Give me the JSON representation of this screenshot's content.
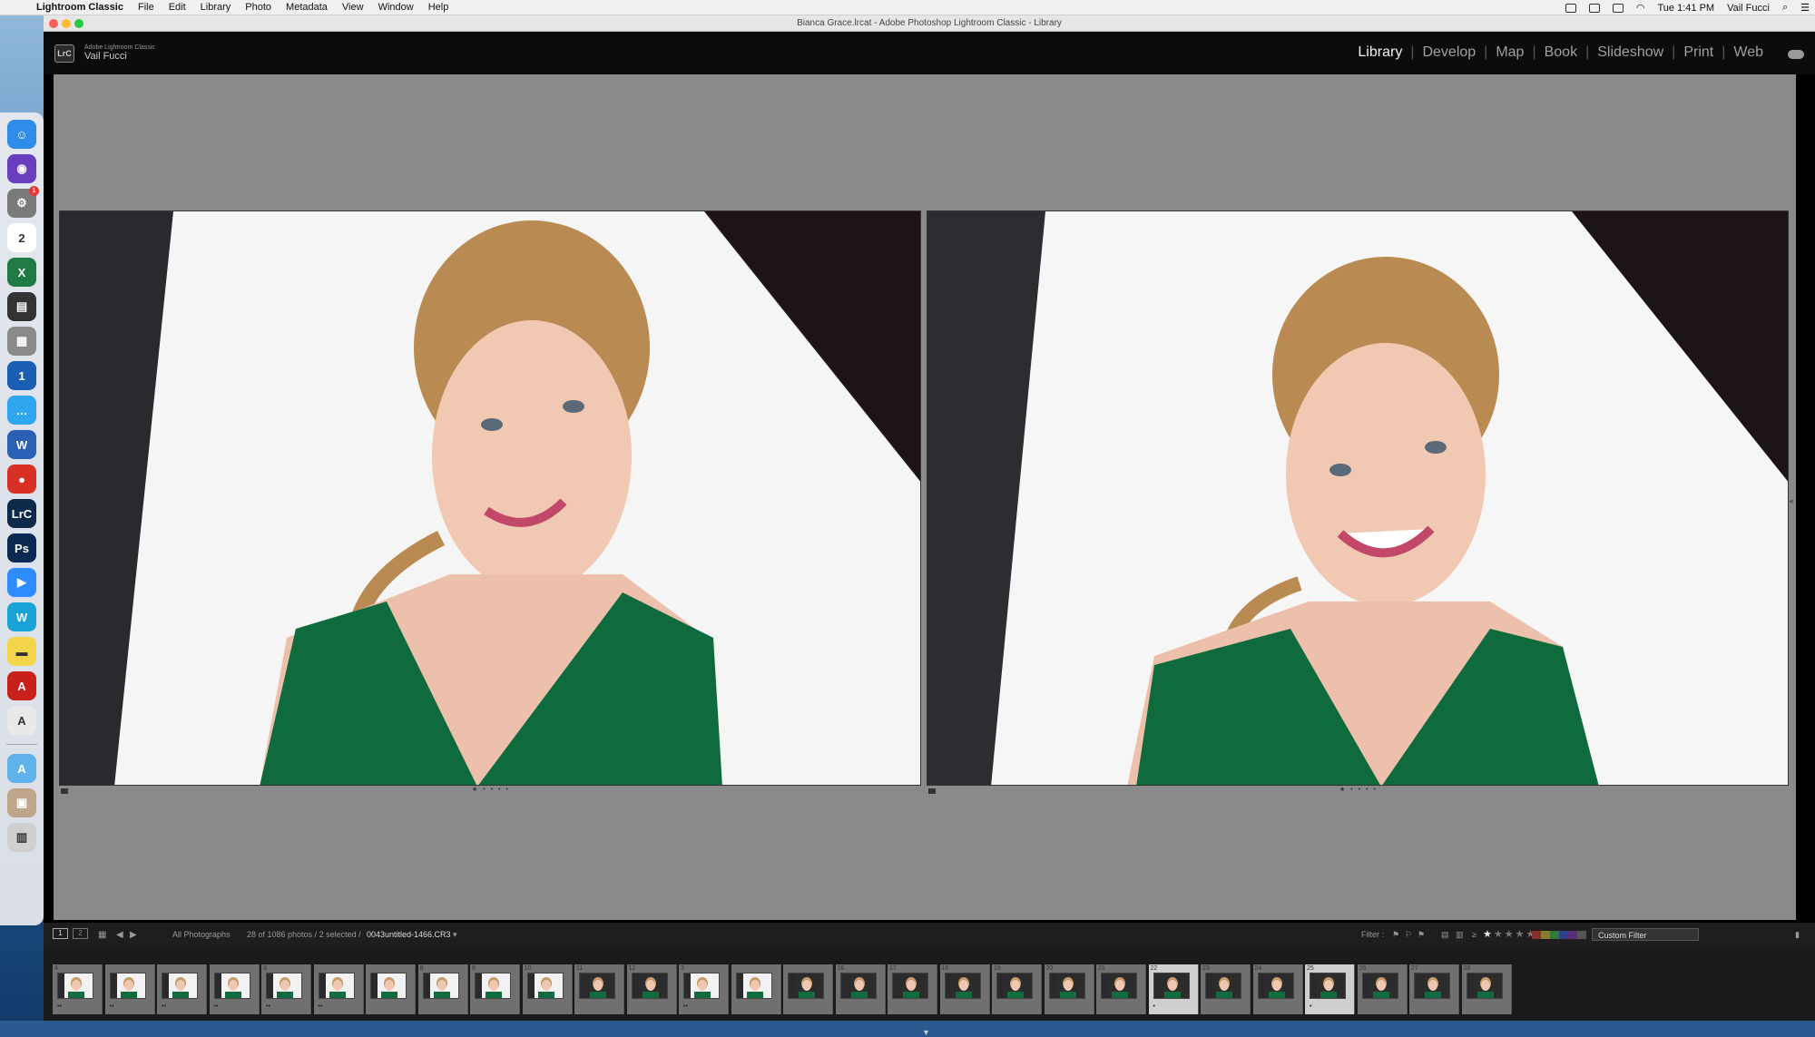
{
  "menubar": {
    "app_name": "Lightroom Classic",
    "items": [
      "File",
      "Edit",
      "Library",
      "Photo",
      "Metadata",
      "View",
      "Window",
      "Help"
    ],
    "clock": "Tue 1:41 PM",
    "user": "Vail Fucci"
  },
  "window": {
    "title": "Bianca Grace.lrcat - Adobe Photoshop Lightroom Classic - Library"
  },
  "identity": {
    "product": "Adobe Lightroom Classic",
    "user": "Vail Fucci",
    "logo_text": "LrC"
  },
  "modules": [
    {
      "label": "Library",
      "active": true
    },
    {
      "label": "Develop",
      "active": false
    },
    {
      "label": "Map",
      "active": false
    },
    {
      "label": "Book",
      "active": false
    },
    {
      "label": "Slideshow",
      "active": false
    },
    {
      "label": "Print",
      "active": false
    },
    {
      "label": "Web",
      "active": false
    }
  ],
  "filmstrip_toolbar": {
    "view1": "1",
    "view2": "2",
    "source": "All Photographs",
    "count": "28 of 1086 photos / 2 selected /",
    "filename": "0043untitled-1466.CR3",
    "filter_label": "Filter :",
    "rating_op": "≥",
    "custom_filter": "Custom Filter"
  },
  "dock": [
    {
      "name": "finder",
      "label": "☺",
      "color": "#2f8ce8"
    },
    {
      "name": "siri",
      "label": "◉",
      "color": "#6a3fbf"
    },
    {
      "name": "system-preferences",
      "label": "⚙",
      "color": "#7a7a7a",
      "badge": "1"
    },
    {
      "name": "calendar",
      "label": "2",
      "color": "#ffffff"
    },
    {
      "name": "excel",
      "label": "X",
      "color": "#1f7a44"
    },
    {
      "name": "printer",
      "label": "▤",
      "color": "#333333"
    },
    {
      "name": "calculator",
      "label": "▦",
      "color": "#8a8a8a"
    },
    {
      "name": "1password",
      "label": "1",
      "color": "#1a5fb4"
    },
    {
      "name": "messages",
      "label": "…",
      "color": "#2fa7f0"
    },
    {
      "name": "word",
      "label": "W",
      "color": "#2b5fb3"
    },
    {
      "name": "chrome",
      "label": "●",
      "color": "#d93025"
    },
    {
      "name": "lightroom-classic",
      "label": "LrC",
      "color": "#0b2a4a"
    },
    {
      "name": "photoshop",
      "label": "Ps",
      "color": "#0a2a52"
    },
    {
      "name": "zoom",
      "label": "▶",
      "color": "#2d8cff"
    },
    {
      "name": "webex",
      "label": "W",
      "color": "#19a2d6"
    },
    {
      "name": "stickies",
      "label": "▬",
      "color": "#f3d54a"
    },
    {
      "name": "acrobat",
      "label": "A",
      "color": "#c8201a"
    },
    {
      "name": "text-edit",
      "label": "A",
      "color": "#e9e9e9"
    },
    {
      "name": "applications-folder",
      "label": "A",
      "color": "#5fb2ea"
    },
    {
      "name": "photo-preview",
      "label": "▣",
      "color": "#bfa58a"
    },
    {
      "name": "trash",
      "label": "▥",
      "color": "#cfcfcf"
    }
  ],
  "filmstrip": {
    "selected_indices": [
      21,
      24
    ],
    "cells": [
      {
        "num": "4",
        "dots": "••",
        "tone": "light"
      },
      {
        "num": "",
        "dots": "••",
        "tone": "light"
      },
      {
        "num": "",
        "dots": "••",
        "tone": "light"
      },
      {
        "num": "",
        "dots": "••",
        "tone": "light"
      },
      {
        "num": "3",
        "dots": "••",
        "tone": "light"
      },
      {
        "num": "",
        "dots": "••",
        "tone": "light"
      },
      {
        "num": "",
        "dots": "",
        "tone": "light"
      },
      {
        "num": "8",
        "dots": "",
        "tone": "light"
      },
      {
        "num": "9",
        "dots": "",
        "tone": "light"
      },
      {
        "num": "10",
        "dots": "",
        "tone": "light"
      },
      {
        "num": "11",
        "dots": "",
        "tone": "dark"
      },
      {
        "num": "12",
        "dots": "",
        "tone": "dark"
      },
      {
        "num": "3",
        "dots": "••",
        "tone": "light"
      },
      {
        "num": "",
        "dots": "",
        "tone": "light"
      },
      {
        "num": "",
        "dots": "",
        "tone": "dark"
      },
      {
        "num": "16",
        "dots": "",
        "tone": "dark"
      },
      {
        "num": "17",
        "dots": "",
        "tone": "dark"
      },
      {
        "num": "18",
        "dots": "",
        "tone": "dark"
      },
      {
        "num": "19",
        "dots": "",
        "tone": "dark"
      },
      {
        "num": "20",
        "dots": "",
        "tone": "dark"
      },
      {
        "num": "21",
        "dots": "",
        "tone": "dark"
      },
      {
        "num": "22",
        "dots": "•",
        "tone": "dark"
      },
      {
        "num": "23",
        "dots": "",
        "tone": "dark"
      },
      {
        "num": "24",
        "dots": "",
        "tone": "dark"
      },
      {
        "num": "25",
        "dots": "•",
        "tone": "dark"
      },
      {
        "num": "26",
        "dots": "",
        "tone": "dark"
      },
      {
        "num": "27",
        "dots": "",
        "tone": "dark"
      },
      {
        "num": "28",
        "dots": "",
        "tone": "dark"
      }
    ]
  },
  "compare": {
    "left_stars": "★ • • • •",
    "right_stars": "★ • • • •"
  },
  "color_labels": [
    "#8a2f2f",
    "#8a7a2f",
    "#2f7a3a",
    "#2f3f8a",
    "#5a2f7a",
    "#555555"
  ]
}
